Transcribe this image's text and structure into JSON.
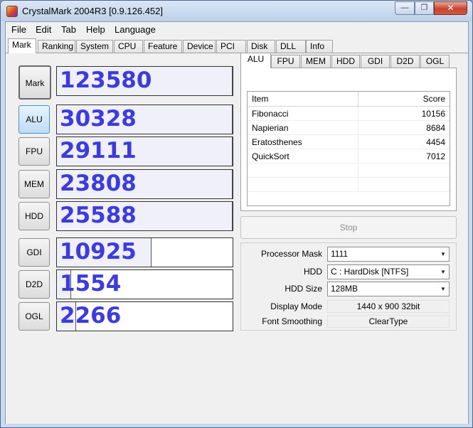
{
  "window": {
    "title": "CrystalMark 2004R3 [0.9.126.452]",
    "min_glyph": "—",
    "max_glyph": "❐",
    "close_glyph": "✕"
  },
  "menu": [
    "File",
    "Edit",
    "Tab",
    "Help",
    "Language"
  ],
  "tabs": [
    "Mark",
    "Ranking",
    "System",
    "CPU",
    "Feature",
    "Device",
    "PCI",
    "Disk",
    "DLL",
    "Info"
  ],
  "scores": [
    {
      "label": "Mark",
      "value": "123580",
      "fill": 1.0
    },
    {
      "label": "ALU",
      "value": "30328",
      "fill": 1.0
    },
    {
      "label": "FPU",
      "value": "29111",
      "fill": 1.0
    },
    {
      "label": "MEM",
      "value": "23808",
      "fill": 1.0
    },
    {
      "label": "HDD",
      "value": "25588",
      "fill": 1.0
    },
    {
      "label": "GDI",
      "value": "10925",
      "fill": 0.54
    },
    {
      "label": "D2D",
      "value": "1554",
      "fill": 0.08
    },
    {
      "label": "OGL",
      "value": "2266",
      "fill": 0.11
    }
  ],
  "subtabs": [
    "ALU",
    "FPU",
    "MEM",
    "HDD",
    "GDI",
    "D2D",
    "OGL"
  ],
  "results": {
    "col_item": "Item",
    "col_score": "Score",
    "rows": [
      {
        "item": "Fibonacci",
        "score": "10156"
      },
      {
        "item": "Napierian",
        "score": "8684"
      },
      {
        "item": "Eratosthenes",
        "score": "4454"
      },
      {
        "item": "QuickSort",
        "score": "7012"
      }
    ]
  },
  "stop_label": "Stop",
  "settings": {
    "processor_mask_label": "Processor Mask",
    "processor_mask_value": "1111",
    "hdd_label": "HDD",
    "hdd_value": "C : HardDisk [NTFS]",
    "hdd_size_label": "HDD Size",
    "hdd_size_value": "128MB",
    "display_mode_label": "Display Mode",
    "display_mode_value": "1440 x 900 32bit",
    "font_smoothing_label": "Font Smoothing",
    "font_smoothing_value": "ClearType"
  }
}
